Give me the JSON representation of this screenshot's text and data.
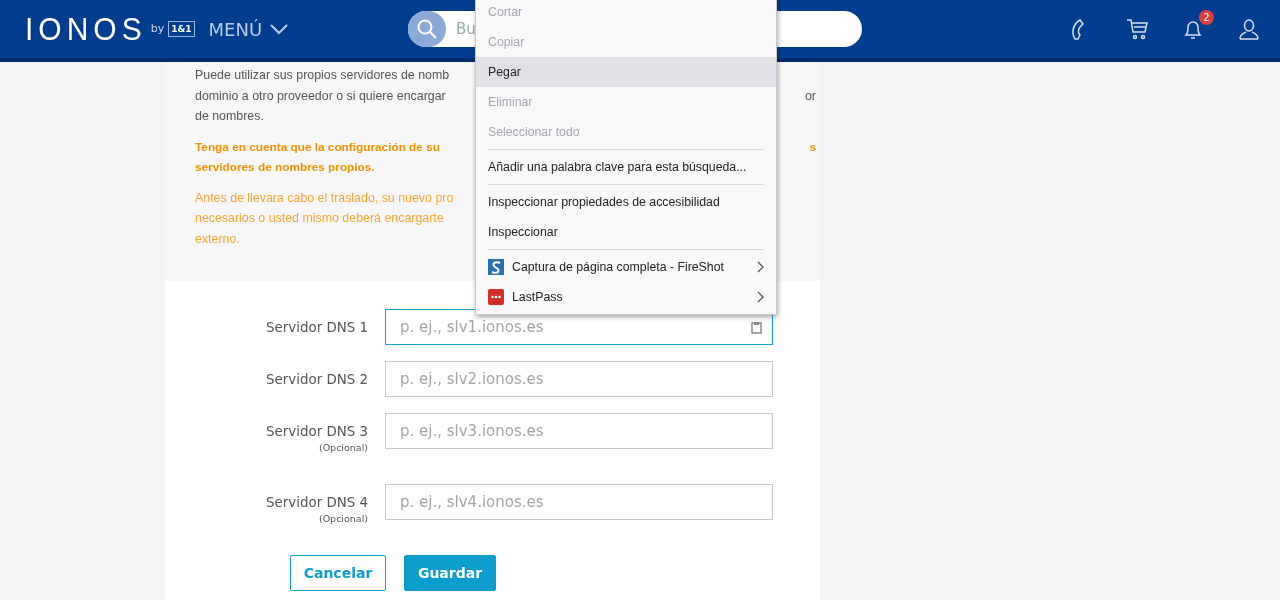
{
  "header": {
    "logo": "IONOS",
    "logo_by": "by",
    "logo_badge": "1&1",
    "menu_label": "MENÚ",
    "search": {
      "placeholder": "Bu"
    },
    "notification_count": "2"
  },
  "intro": [
    {
      "kind": "normal",
      "lines": [
        {
          "left": "Puede utilizar sus propios servidores de nomb"
        },
        {
          "left": "dominio a otro proveedor o si quiere encargar",
          "right": "or"
        },
        {
          "left": "de nombres."
        }
      ]
    },
    {
      "kind": "warning",
      "lines": [
        {
          "left": "Tenga en cuenta que la configuración de su",
          "right": "s"
        },
        {
          "left": "servidores de nombres propios."
        }
      ]
    },
    {
      "kind": "note",
      "lines": [
        {
          "left": "Antes de llevara cabo el traslado, su nuevo pro"
        },
        {
          "left": "necesarios o usted mismo deberá encargarte"
        },
        {
          "left": "externo."
        }
      ]
    }
  ],
  "dns_fields": [
    {
      "label": "Servidor DNS 1",
      "placeholder": "p. ej., slv1.ionos.es",
      "focused": true
    },
    {
      "label": "Servidor DNS 2",
      "placeholder": "p. ej., slv2.ionos.es",
      "focused": false
    },
    {
      "label": "Servidor DNS 3",
      "note": "(Opcional)",
      "placeholder": "p. ej., slv3.ionos.es",
      "focused": false
    },
    {
      "label": "Servidor DNS 4",
      "note": "(Opcional)",
      "placeholder": "p. ej., slv4.ionos.es",
      "focused": false
    }
  ],
  "buttons": [
    {
      "label": "Cancelar",
      "kind": "secondary"
    },
    {
      "label": "Guardar",
      "kind": "primary"
    }
  ],
  "context_menu": [
    {
      "kind": "item",
      "label": "Cortar",
      "disabled": true,
      "selected": false
    },
    {
      "kind": "item",
      "label": "Copiar",
      "disabled": true,
      "selected": false
    },
    {
      "kind": "item",
      "label": "Pegar",
      "disabled": false,
      "selected": true
    },
    {
      "kind": "item",
      "label": "Eliminar",
      "disabled": true,
      "selected": false
    },
    {
      "kind": "item",
      "label": "Seleccionar todo",
      "disabled": true,
      "selected": false
    },
    {
      "kind": "separator"
    },
    {
      "kind": "item",
      "label": "Añadir una palabra clave para esta búsqueda...",
      "disabled": false,
      "selected": false
    },
    {
      "kind": "separator"
    },
    {
      "kind": "item",
      "label": "Inspeccionar propiedades de accesibilidad",
      "disabled": false,
      "selected": false
    },
    {
      "kind": "item",
      "label": "Inspeccionar",
      "disabled": false,
      "selected": false
    },
    {
      "kind": "separator"
    },
    {
      "kind": "submenu",
      "label": "Captura de página completa - FireShot",
      "disabled": false,
      "selected": false
    },
    {
      "kind": "submenu",
      "label": "LastPass",
      "disabled": false,
      "selected": false
    }
  ]
}
